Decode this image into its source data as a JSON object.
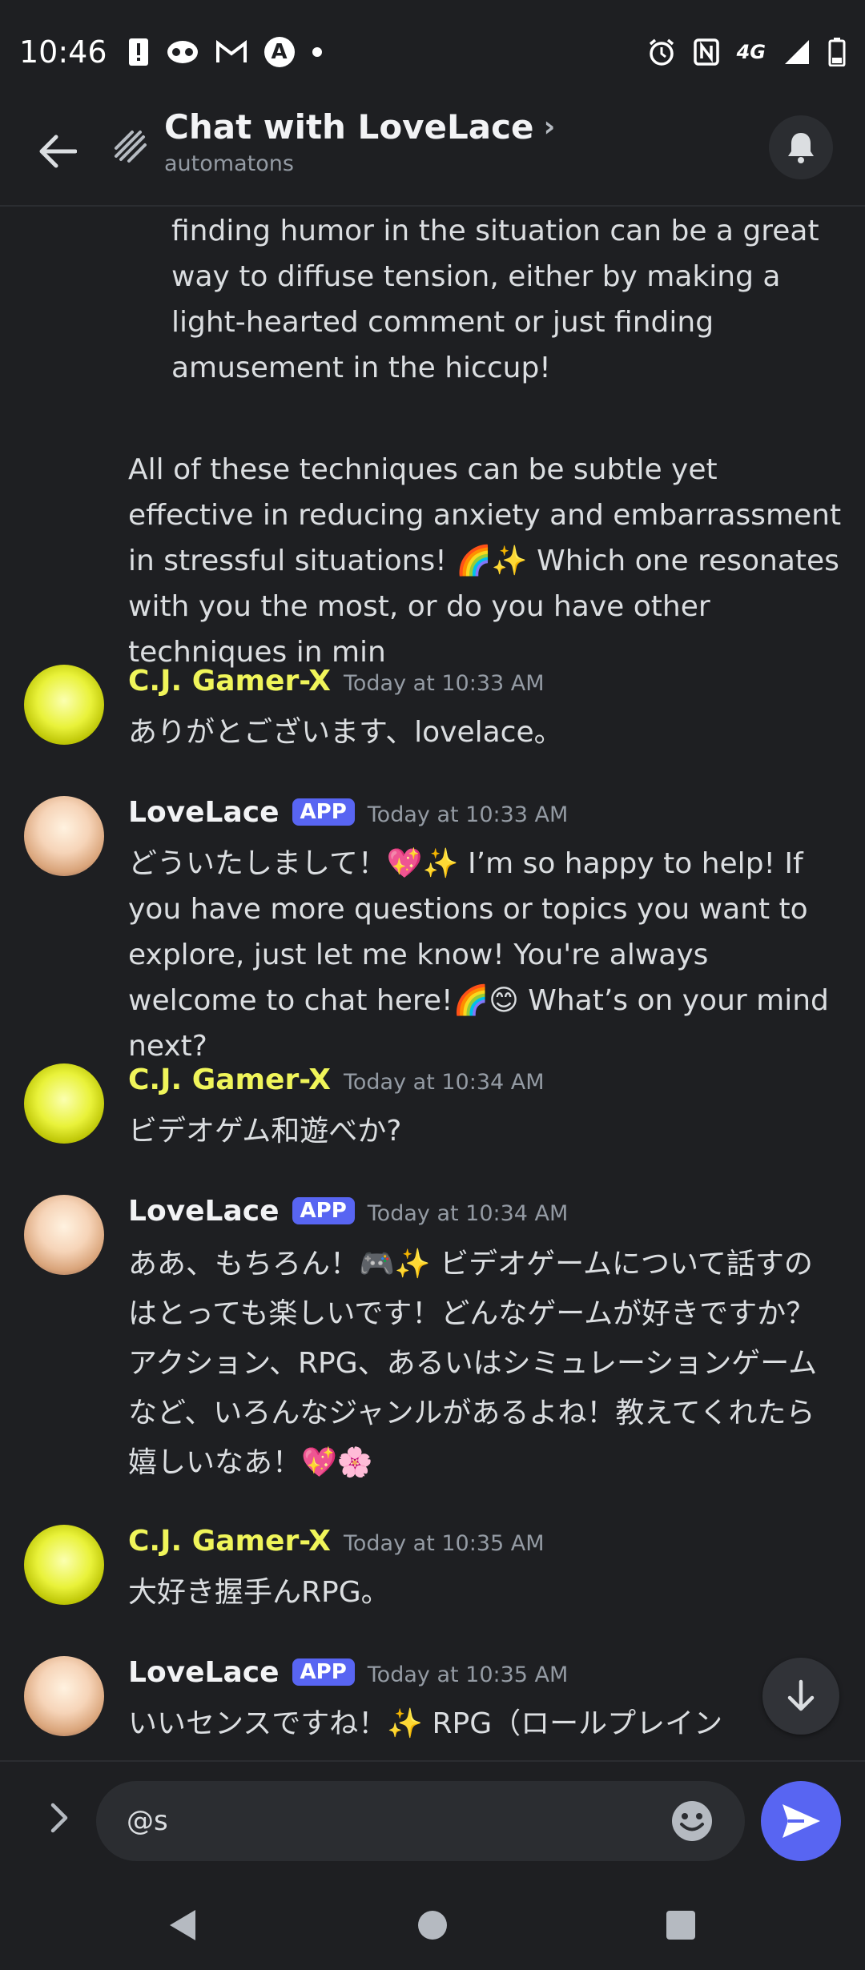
{
  "status_bar": {
    "time": "10:46",
    "network_label": "4G"
  },
  "header": {
    "title": "Chat with LoveLace",
    "subtitle": "automatons"
  },
  "partial_message": {
    "list_item_text": "finding humor in the situation can be a great way to diffuse tension, either by making a light-hearted comment or just finding amusement in the hiccup!",
    "paragraph_text": "All of these techniques can be subtle yet effective in reducing anxiety and embarrassment in stressful situations! 🌈✨ Which one resonates with you the most, or do you have other techniques in min"
  },
  "messages": [
    {
      "author": "C.J. Gamer-X",
      "timestamp": "Today at 10:33 AM",
      "text": "ありがとございます、lovelace。"
    },
    {
      "author": "LoveLace",
      "badge": "APP",
      "timestamp": "Today at 10:33 AM",
      "text": "どういたしまして！💖✨ I’m so happy to help! If you have more questions or topics you want to explore, just let me know! You're always welcome to chat here!🌈😊 What’s on your mind next?"
    },
    {
      "author": "C.J. Gamer-X",
      "timestamp": "Today at 10:34 AM",
      "text": "ビデオゲム和遊べか?"
    },
    {
      "author": "LoveLace",
      "badge": "APP",
      "timestamp": "Today at 10:34 AM",
      "text": "ああ、もちろん！🎮✨ ビデオゲームについて話すのはとっても楽しいです！どんなゲームが好きですか？アクション、RPG、あるいはシミュレーションゲームなど、いろんなジャンルがあるよね！教えてくれたら嬉しいなあ！💖🌸"
    },
    {
      "author": "C.J. Gamer-X",
      "timestamp": "Today at 10:35 AM",
      "text": "大好き握手んRPG。"
    },
    {
      "author": "LoveLace",
      "badge": "APP",
      "timestamp": "Today at 10:35 AM",
      "text": "いいセンスですね！✨ RPG（ロールプレイン"
    }
  ],
  "composer": {
    "input_value": "@s"
  },
  "colors": {
    "background": "#1e1f22",
    "accent": "#5865f2",
    "cj_name": "#f0f55a",
    "muted": "#949ba4"
  }
}
